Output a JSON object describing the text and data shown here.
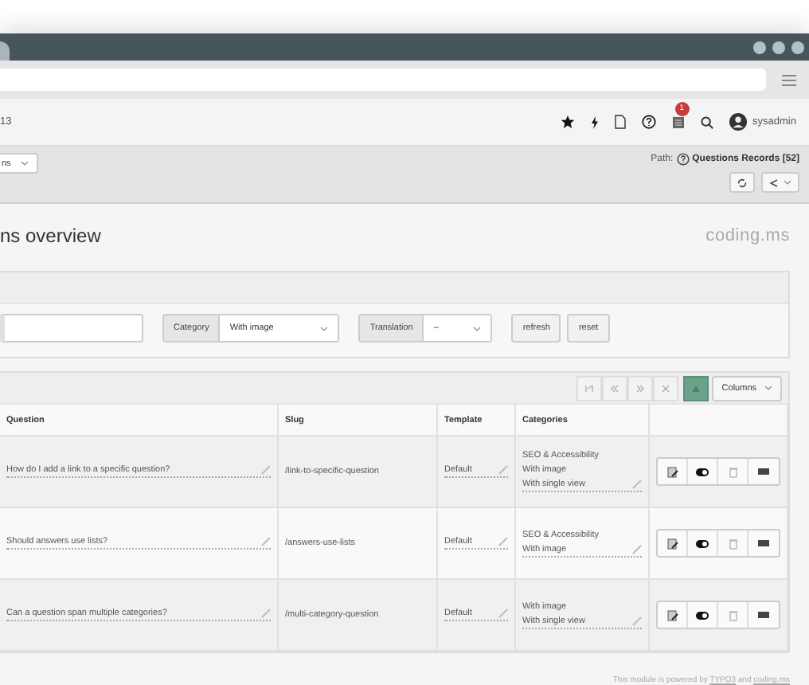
{
  "top_bar": {
    "site": "13",
    "notification_count": "1",
    "user": "sysadmin"
  },
  "docheader": {
    "module_menu": "ns",
    "path_label": "Path:",
    "path_record": "Questions Records [52]"
  },
  "page": {
    "title": "ns overview",
    "logo": "coding.ms"
  },
  "filter": {
    "fields": [
      {
        "kind": "text"
      },
      {
        "kind": "select",
        "label": "Category",
        "value": "With image"
      },
      {
        "kind": "select",
        "label": "Translation",
        "value": "–"
      }
    ],
    "buttons": [
      "refresh",
      "reset"
    ]
  },
  "table": {
    "columns_button": "Columns",
    "columns": [
      "Question",
      "Slug",
      "Template",
      "Categories"
    ],
    "rows": [
      {
        "question": "How do I add a link to a specific question?",
        "slug": "/link-to-specific-question",
        "template": "Default",
        "categories": [
          "SEO & Accessibility",
          "With image",
          "With single view"
        ]
      },
      {
        "question": "Should answers use lists?",
        "slug": "/answers-use-lists",
        "template": "Default",
        "categories": [
          "SEO & Accessibility",
          "With image"
        ]
      },
      {
        "question": "Can a question span multiple categories?",
        "slug": "/multi-category-question",
        "template": "Default",
        "categories": [
          "With image",
          "With single view"
        ]
      }
    ]
  },
  "footer": {
    "prefix": "This module is powered by",
    "link_1": "TYPO3",
    "joiner": "and",
    "link_2": "coding.ms"
  }
}
